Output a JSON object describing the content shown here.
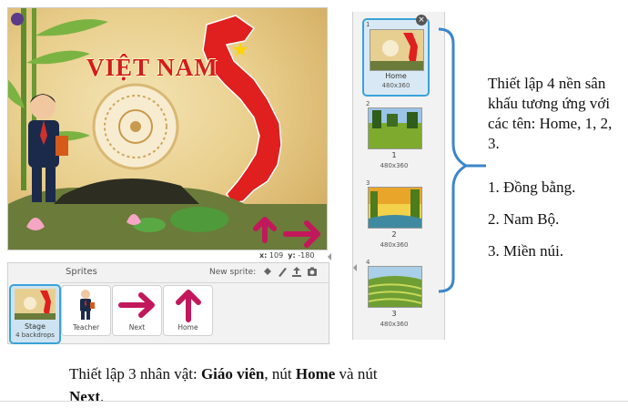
{
  "stage": {
    "title": "VIỆT NAM",
    "coords": {
      "x_label": "x:",
      "x_value": "109",
      "y_label": "y:",
      "y_value": "-180"
    }
  },
  "sprites_pane": {
    "label": "Sprites",
    "new_sprite_label": "New sprite:",
    "stage_tile": {
      "name": "Stage",
      "subtitle": "4 backdrops"
    },
    "sprites": [
      {
        "name": "Teacher",
        "icon": "teacher-icon"
      },
      {
        "name": "Next",
        "icon": "right-arrow-icon"
      },
      {
        "name": "Home",
        "icon": "up-arrow-icon"
      }
    ]
  },
  "backdrops": [
    {
      "number": "1",
      "name": "Home",
      "size": "480x360",
      "selected": true
    },
    {
      "number": "2",
      "name": "1",
      "size": "480x360",
      "selected": false
    },
    {
      "number": "3",
      "name": "2",
      "size": "480x360",
      "selected": false
    },
    {
      "number": "4",
      "name": "3",
      "size": "480x360",
      "selected": false
    }
  ],
  "annotations": {
    "right_text": "Thiết lập 4 nền sân khấu tương ứng với các tên: Home, 1, 2, 3.",
    "right_items": [
      "1. Đồng bằng.",
      "2. Nam Bộ.",
      "3. Miền núi."
    ],
    "bottom_prefix": "Thiết lập 3 nhân vật: ",
    "bottom_bold1": "Giáo viên",
    "bottom_mid": ", nút ",
    "bottom_bold2": "Home",
    "bottom_mid2": " và nút ",
    "bottom_bold3": "Next",
    "bottom_suffix": "."
  },
  "colors": {
    "accent": "#3aa2d8",
    "arrow_magenta": "#c2185b",
    "map_red": "#e01f1f",
    "bracket_blue": "#3b86c9"
  }
}
